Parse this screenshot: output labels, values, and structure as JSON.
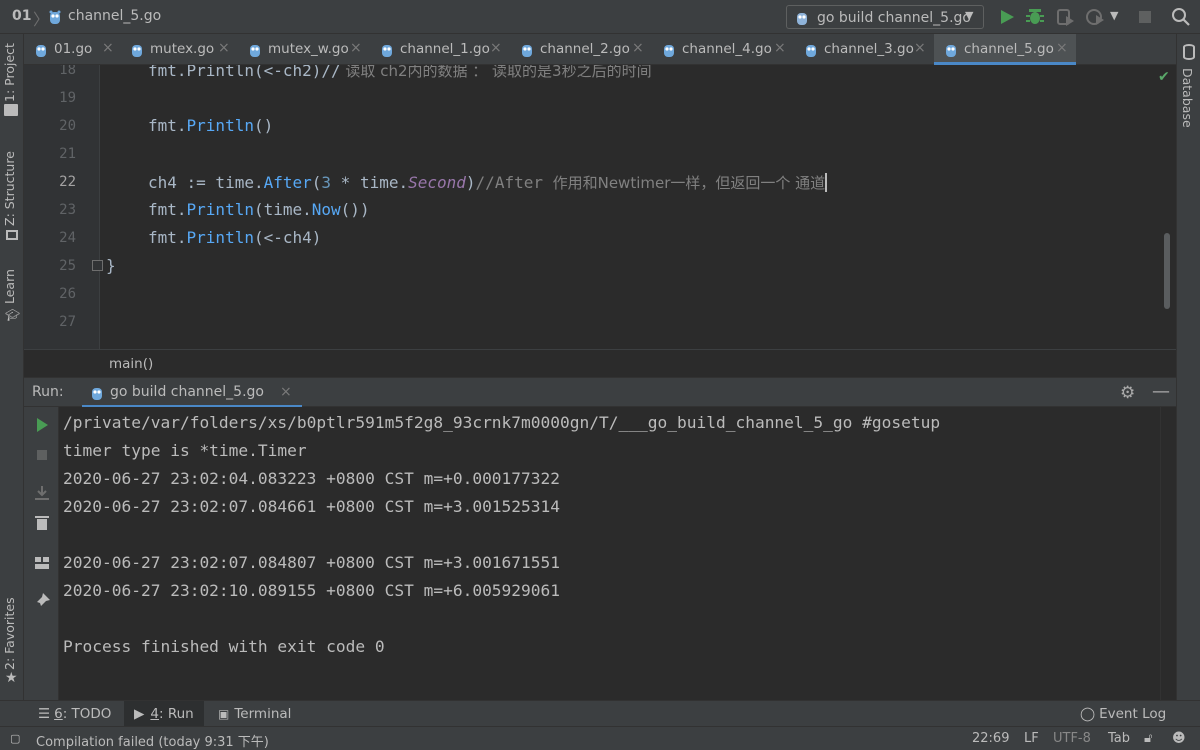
{
  "navbar": {
    "project": "01",
    "file": "channel_5.go",
    "run_config": "go build channel_5.go"
  },
  "colors": {
    "accent": "#4a88c7",
    "run_green": "#499c54",
    "keyword_fn": "#57a8f5",
    "comment": "#808080",
    "constant": "#9876aa"
  },
  "left_strip": {
    "project": "1: Project",
    "structure": "Z: Structure",
    "learn": "Learn",
    "favorites": "2: Favorites"
  },
  "right_strip": {
    "database": "Database"
  },
  "tabs": [
    {
      "label": "01.go"
    },
    {
      "label": "mutex.go"
    },
    {
      "label": "mutex_w.go"
    },
    {
      "label": "channel_1.go"
    },
    {
      "label": "channel_2.go"
    },
    {
      "label": "channel_4.go"
    },
    {
      "label": "channel_3.go"
    },
    {
      "label": "channel_5.go",
      "active": true
    }
  ],
  "editor": {
    "line_numbers": [
      "18",
      "19",
      "20",
      "21",
      "22",
      "23",
      "24",
      "25",
      "26",
      "27"
    ],
    "current_line": "22",
    "lines": {
      "l18_code": "fmt.Println(<-ch2)//",
      "l18_comment": " 读取 ch2内的数据 ： 读取的是3秒之后的时间",
      "l20_pkg": "fmt.",
      "l20_fn": "Println",
      "l20_rest": "()",
      "l22_a": "ch4 := time.",
      "l22_fn": "After",
      "l22_b": "(",
      "l22_num": "3",
      "l22_c": " * time.",
      "l22_const": "Second",
      "l22_d": ")",
      "l22_comment_en": "//After ",
      "l22_comment_zh": "作用和Newtimer一样，但返回一个 通道",
      "l23_pkg": "fmt.",
      "l23_fn": "Println",
      "l23_b": "(time.",
      "l23_fn2": "Now",
      "l23_rest": "())",
      "l24_pkg": "fmt.",
      "l24_fn": "Println",
      "l24_rest": "(<-ch4)",
      "l25": "}"
    }
  },
  "breadcrumb": {
    "label": "main()"
  },
  "run_panel": {
    "title": "Run:",
    "tab_label": "go build channel_5.go",
    "console_lines": [
      "/private/var/folders/xs/b0ptlr591m5f2g8_93crnk7m0000gn/T/___go_build_channel_5_go #gosetup",
      "timer type is *time.Timer",
      "2020-06-27 23:02:04.083223 +0800 CST m=+0.000177322",
      "2020-06-27 23:02:07.084661 +0800 CST m=+3.001525314",
      "",
      "2020-06-27 23:02:07.084807 +0800 CST m=+3.001671551",
      "2020-06-27 23:02:10.089155 +0800 CST m=+6.005929061",
      "",
      "Process finished with exit code 0"
    ]
  },
  "tool_tabs": {
    "todo_num": "6",
    "todo_label": ": TODO",
    "run_num": "4",
    "run_label": ": Run",
    "terminal": "Terminal",
    "event_log": "Event Log"
  },
  "statusbar": {
    "message": "Compilation failed (today 9:31 下午)",
    "position": "22:69",
    "line_sep": "LF",
    "encoding": "UTF-8",
    "indent": "Tab"
  }
}
